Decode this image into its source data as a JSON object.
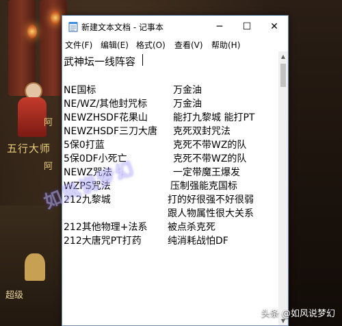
{
  "background": {
    "npc_name": "五行大师",
    "npc_side_1": "阿",
    "npc_side_2": "阿",
    "jianghu_text": "超级",
    "watermark": "如风说梦幻",
    "credit": "头条 @如风说梦幻"
  },
  "window": {
    "title": "新建文本文档 - 记事本",
    "minimize_glyph": "─",
    "maximize_glyph": "☐",
    "close_glyph": "✕"
  },
  "menu": {
    "file": "文件(F)",
    "edit": "编辑(E)",
    "format": "格式(O)",
    "view": "查看(V)",
    "help": "帮助(H)"
  },
  "document": {
    "title": "武神坛一线阵容",
    "rows": [
      {
        "team": "NE国标",
        "note": "万金油"
      },
      {
        "team": "NE/WZ/其他封咒标",
        "note": "万金油"
      },
      {
        "team": "NEWZHSDF花果山",
        "note": "能打九黎城 能打PT"
      },
      {
        "team": "NEWZHSDF三刀大唐",
        "note": "克死双封咒法"
      },
      {
        "team": "5保0打蓝",
        "note": "克死不带WZ的队"
      },
      {
        "team": "5保0DF小死亡",
        "note": "克死不带WZ的队"
      },
      {
        "team": "NEWZ咒法",
        "note": "一定带魔王爆发"
      },
      {
        "team": "WZPS咒法",
        "note": "压制强能克国标"
      },
      {
        "team": "212九黎城",
        "note": "打的好很强不好很弱"
      },
      {
        "team": "",
        "note": "跟人物属性很大关系"
      },
      {
        "team": "212其他物理+法系",
        "note": "被点杀克死"
      },
      {
        "team": "212大唐咒PT打药",
        "note": "纯消耗战怕DF"
      }
    ]
  },
  "colors": {
    "window_border": "#6b8cb5",
    "npc_text": "#e9cf7a",
    "watermark": "#b9b2ff"
  }
}
